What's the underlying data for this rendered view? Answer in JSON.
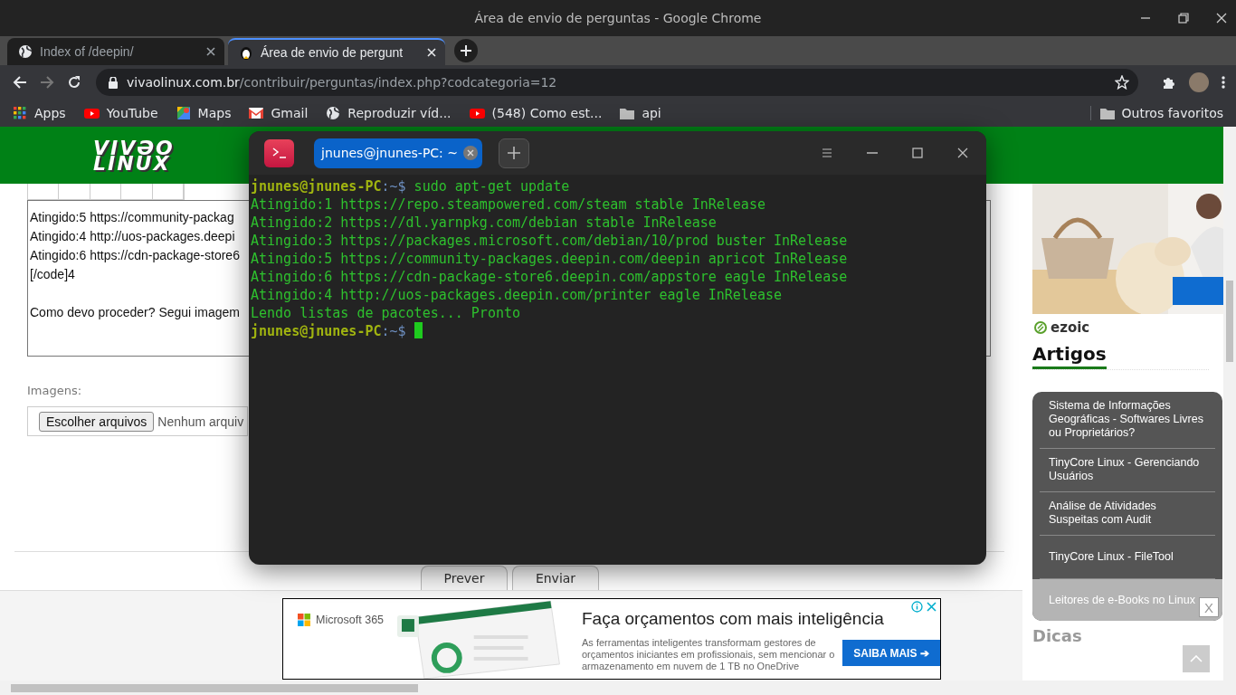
{
  "window": {
    "title": "Área de envio de perguntas - Google Chrome"
  },
  "tabs": [
    {
      "title": "Index of /deepin/",
      "selected": false
    },
    {
      "title": "Área de envio de pergunt",
      "selected": true
    }
  ],
  "address_bar": {
    "domain": "vivaolinux.com.br",
    "path": "/contribuir/perguntas/index.php?codcategoria=12"
  },
  "bookmarks": [
    {
      "label": "Apps",
      "kind": "apps"
    },
    {
      "label": "YouTube",
      "kind": "youtube"
    },
    {
      "label": "Maps",
      "kind": "maps"
    },
    {
      "label": "Gmail",
      "kind": "gmail"
    },
    {
      "label": "Reproduzir víd...",
      "kind": "globe"
    },
    {
      "label": "(548) Como est...",
      "kind": "youtube"
    },
    {
      "label": "api",
      "kind": "folder"
    }
  ],
  "other_bookmarks": "Outros favoritos",
  "page": {
    "logo": [
      "VIVƏO",
      "LINUX"
    ],
    "editor_paragraphs": [
      [
        "Atingido:5 https://community-packag",
        "Atingido:4 http://uos-packages.deepi",
        "Atingido:6 https://cdn-package-store6",
        "[/code]4"
      ],
      [
        "Como devo proceder? Segui imagem"
      ]
    ],
    "images_label": "Imagens:",
    "file_button": "Escolher arquivos",
    "file_status": "Nenhum arquiv",
    "buttons": [
      "Prever",
      "Enviar"
    ]
  },
  "sidebar": {
    "sponsor": "ezoic",
    "heading": "Artigos",
    "articles": [
      {
        "title": "Sistema de Informações Geográficas - Softwares Livres ou Proprietários?",
        "covered": false
      },
      {
        "title": "TinyCore Linux - Gerenciando Usuários",
        "covered": false
      },
      {
        "title": "Análise de Atividades Suspeitas com Audit",
        "covered": false
      },
      {
        "title": "TinyCore Linux - FileTool",
        "covered": false
      },
      {
        "title": "Leitores de e-Books no Linux",
        "covered": true
      }
    ],
    "next_heading": "Dicas"
  },
  "ad_banner": {
    "brand": "Microsoft 365",
    "headline": "Faça orçamentos com mais inteligência",
    "body": "As ferramentas inteligentes transformam gestores de orçamentos iniciantes em profissionais, sem mencionar o armazenamento em nuvem de 1 TB no OneDrive",
    "cta": "SAIBA MAIS ➔",
    "close": "X"
  },
  "terminal": {
    "tab_title": "jnunes@jnunes-PC: ~",
    "lines": [
      {
        "kind": "prompt",
        "user": "jnunes@jnunes-PC",
        "path": ":~$",
        "command": "sudo apt-get update"
      },
      {
        "kind": "output",
        "text": "Atingido:1 https://repo.steampowered.com/steam stable InRelease"
      },
      {
        "kind": "output",
        "text": "Atingido:2 https://dl.yarnpkg.com/debian stable InRelease"
      },
      {
        "kind": "output",
        "text": "Atingido:3 https://packages.microsoft.com/debian/10/prod buster InRelease"
      },
      {
        "kind": "output",
        "text": "Atingido:5 https://community-packages.deepin.com/deepin apricot InRelease"
      },
      {
        "kind": "output",
        "text": "Atingido:6 https://cdn-package-store6.deepin.com/appstore eagle InRelease"
      },
      {
        "kind": "output",
        "text": "Atingido:4 http://uos-packages.deepin.com/printer eagle InRelease"
      },
      {
        "kind": "output",
        "text": "Lendo listas de pacotes... Pronto"
      },
      {
        "kind": "prompt",
        "user": "jnunes@jnunes-PC",
        "path": ":~$",
        "cursor": true
      }
    ]
  }
}
